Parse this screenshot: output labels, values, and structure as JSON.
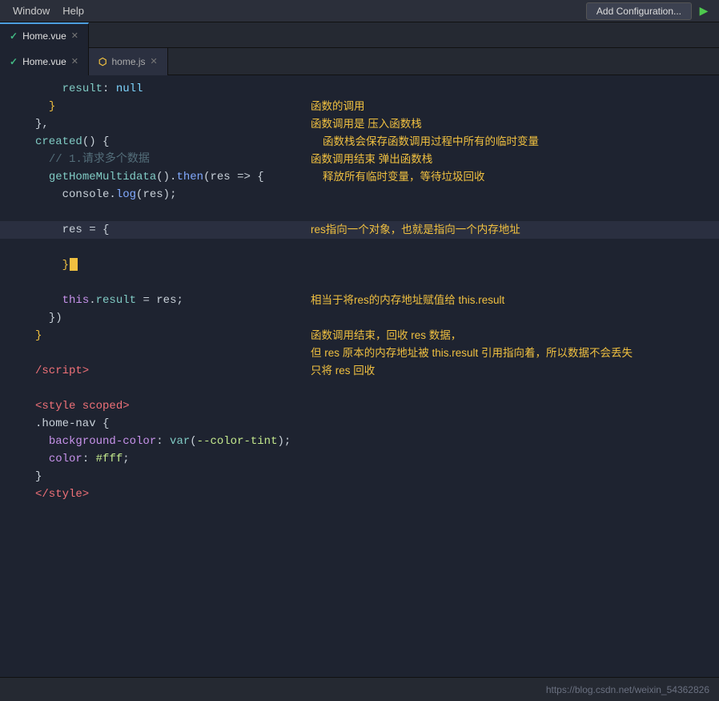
{
  "menubar": {
    "items": [
      "Window",
      "Help"
    ],
    "add_config_label": "Add Configuration...",
    "run_icon": "▶"
  },
  "tabs_top": [
    {
      "name": "Home.vue",
      "active": true,
      "type": "vue"
    }
  ],
  "editor_tabs": [
    {
      "name": "Home.vue",
      "active": true,
      "type": "vue",
      "modified": true
    },
    {
      "name": "home.js",
      "active": false,
      "type": "js",
      "modified": false
    }
  ],
  "code_lines": [
    {
      "num": "",
      "text": "    result: null"
    },
    {
      "num": "",
      "text": "  }"
    },
    {
      "num": "",
      "text": "},"
    },
    {
      "num": "",
      "text": "created() {"
    },
    {
      "num": "",
      "text": "  // 1.请求多个数据"
    },
    {
      "num": "",
      "text": "  getHomeMultidata().then(res => {"
    },
    {
      "num": "",
      "text": "    console.log(res);"
    },
    {
      "num": "",
      "text": ""
    },
    {
      "num": "",
      "text": "    res = {"
    },
    {
      "num": "",
      "text": ""
    },
    {
      "num": "",
      "text": "    }"
    },
    {
      "num": "",
      "text": ""
    },
    {
      "num": "",
      "text": "    this.result = res;"
    },
    {
      "num": "",
      "text": "  })"
    },
    {
      "num": "",
      "text": "}"
    },
    {
      "num": "",
      "text": ""
    },
    {
      "num": "",
      "text": "<script>"
    },
    {
      "num": "",
      "text": ""
    },
    {
      "num": "",
      "text": "<style scoped>"
    },
    {
      "num": "",
      "text": ".home-nav {"
    },
    {
      "num": "",
      "text": "  background-color: var(--color-tint);"
    },
    {
      "num": "",
      "text": "  color: #fff;"
    },
    {
      "num": "",
      "text": "}"
    },
    {
      "num": "",
      "text": "</style>"
    }
  ],
  "annotations": {
    "func_call": "函数的调用",
    "func_push": "函数调用是 压入函数栈",
    "func_stack_save": "    函数栈会保存函数调用过程中所有的临时变量",
    "func_pop": "函数调用结束 弹出函数栈",
    "func_release": "    释放所有临时变量，等待垃圾回收",
    "res_points": "res指向一个对象，也就是指向一个内存地址",
    "this_result": "相当于将res的内存地址赋值给 this.result",
    "func_end": "函数调用结束，回收 res 数据，",
    "res_ref": "但 res 原本的内存地址被 this.result 引用指向着，所以数据不会丢失",
    "only_res": "只将 res 回收"
  },
  "status": {
    "url": "https://blog.csdn.net/weixin_54362826"
  }
}
